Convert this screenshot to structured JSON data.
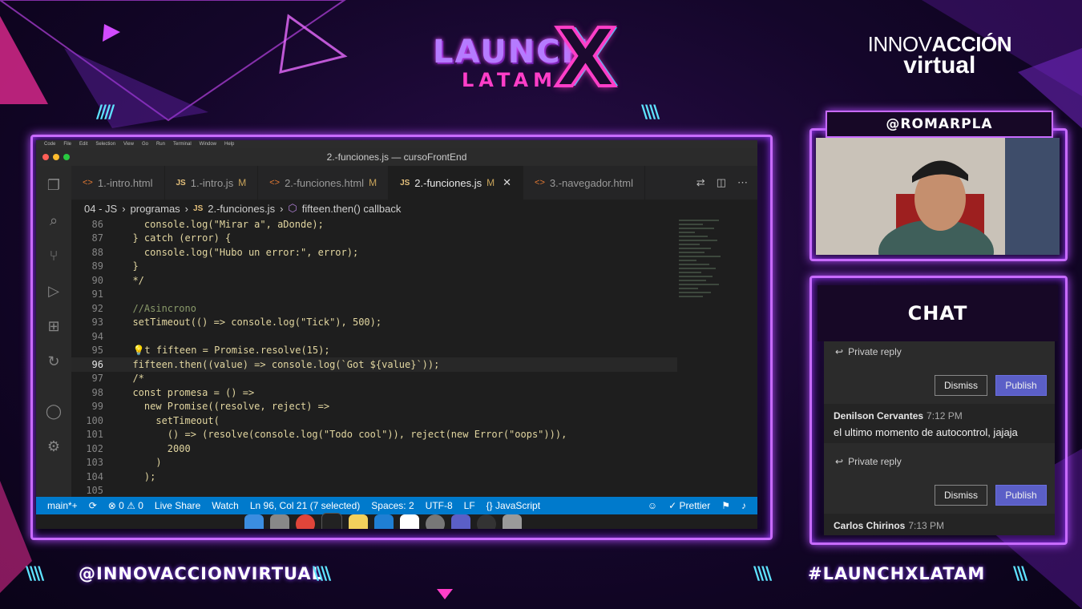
{
  "overlay": {
    "logo_launch": "LAUNCH",
    "logo_latam": "LATAM",
    "logo_x": "X",
    "brand_line1_a": "INNOV",
    "brand_line1_b": "ACCIÓN",
    "brand_line2": "virtual",
    "cam_handle": "@ROMARPLA",
    "bottom_left_handle": "@INNOVACCIONVIRTUAL",
    "bottom_right_hashtag": "#LAUNCHXLATAM",
    "chat_title": "CHAT"
  },
  "mac_menu": [
    "Code",
    "File",
    "Edit",
    "Selection",
    "View",
    "Go",
    "Run",
    "Terminal",
    "Window",
    "Help"
  ],
  "editor": {
    "window_title": "2.-funciones.js — cursoFrontEnd",
    "tabs": [
      {
        "label": "1.-intro.html",
        "type": "html",
        "modified": "",
        "active": false
      },
      {
        "label": "1.-intro.js",
        "type": "js",
        "modified": "M",
        "active": false
      },
      {
        "label": "2.-funciones.html",
        "type": "html",
        "modified": "M",
        "active": false
      },
      {
        "label": "2.-funciones.js",
        "type": "js",
        "modified": "M",
        "active": true
      },
      {
        "label": "3.-navegador.html",
        "type": "html",
        "modified": "",
        "active": false
      }
    ],
    "breadcrumb": [
      "04 - JS",
      "programas",
      "2.-funciones.js",
      "fifteen.then() callback"
    ],
    "lines": [
      {
        "n": "86",
        "code": "    console.log(\"Mirar a\", aDonde);"
      },
      {
        "n": "87",
        "code": "  } catch (error) {"
      },
      {
        "n": "88",
        "code": "    console.log(\"Hubo un error:\", error);"
      },
      {
        "n": "89",
        "code": "  }"
      },
      {
        "n": "90",
        "code": "  */"
      },
      {
        "n": "91",
        "code": ""
      },
      {
        "n": "92",
        "code": "  //Asincrono"
      },
      {
        "n": "93",
        "code": "  setTimeout(() => console.log(\"Tick\"), 500);"
      },
      {
        "n": "94",
        "code": ""
      },
      {
        "n": "95",
        "code": "  💡t fifteen = Promise.resolve(15);"
      },
      {
        "n": "96",
        "code": "  fifteen.then((value) => console.log(`Got ${value}`));"
      },
      {
        "n": "97",
        "code": "  /*"
      },
      {
        "n": "98",
        "code": "  const promesa = () =>"
      },
      {
        "n": "99",
        "code": "    new Promise((resolve, reject) =>"
      },
      {
        "n": "100",
        "code": "      setTimeout("
      },
      {
        "n": "101",
        "code": "        () => (resolve(console.log(\"Todo cool\")), reject(new Error(\"oops\"))),"
      },
      {
        "n": "102",
        "code": "        2000"
      },
      {
        "n": "103",
        "code": "      )"
      },
      {
        "n": "104",
        "code": "    );"
      },
      {
        "n": "105",
        "code": ""
      }
    ],
    "status": {
      "branch": "main*+",
      "errors": "⊗ 0 ⚠ 0",
      "live_share": "Live Share",
      "watch": "Watch",
      "position": "Ln 96, Col 21 (7 selected)",
      "spaces": "Spaces: 2",
      "encoding": "UTF-8",
      "eol": "LF",
      "language": "{} JavaScript",
      "prettier": "✓ Prettier"
    }
  },
  "chat": {
    "private_reply": "Private reply",
    "dismiss": "Dismiss",
    "publish": "Publish",
    "messages": [
      {
        "author": "Denilson Cervantes",
        "time": "7:12 PM",
        "text": "el ultimo momento de autocontrol, jajaja"
      },
      {
        "author": "Carlos Chirinos",
        "time": "7:13 PM",
        "text": ""
      }
    ]
  },
  "colors": {
    "neon_purple": "#c86bff",
    "neon_pink": "#ff3ec8",
    "neon_cyan": "#5ee2ff",
    "vscode_status": "#007acc",
    "publish": "#5b5fc7"
  }
}
